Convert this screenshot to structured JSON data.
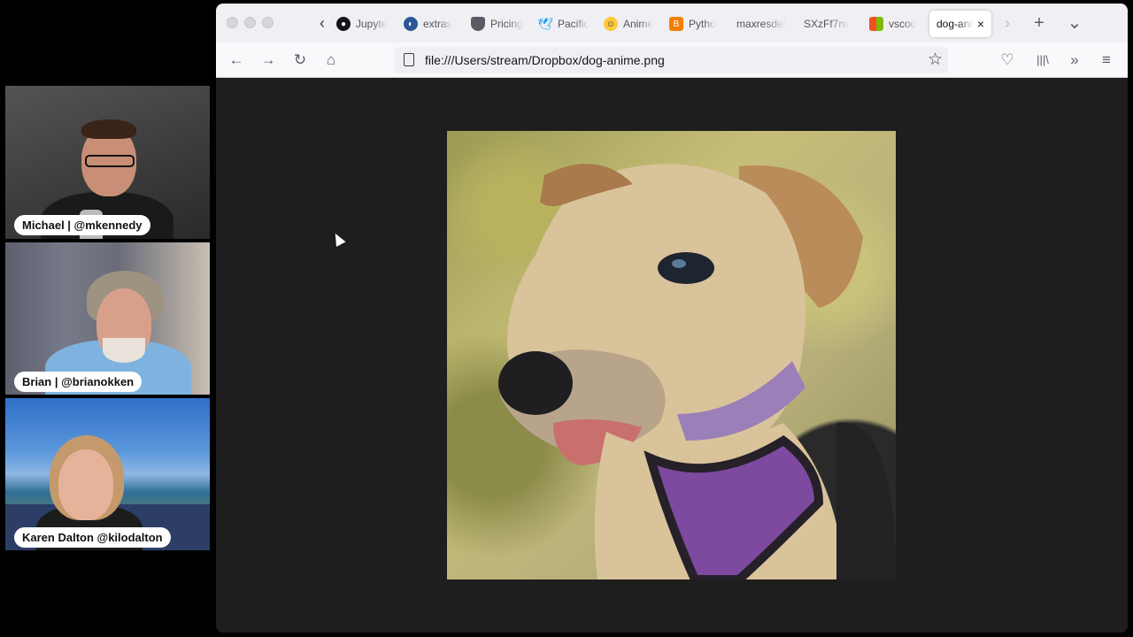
{
  "participants": [
    {
      "name": "Michael | @mkennedy"
    },
    {
      "name": "Brian | @brianokken"
    },
    {
      "name": "Karen Dalton @kilodalton"
    }
  ],
  "browser": {
    "tabs": [
      {
        "title": "Jupyte",
        "icon": "github-icon",
        "color": "#15141a"
      },
      {
        "title": "extras",
        "icon": "globe-icon",
        "color": "#2b5797"
      },
      {
        "title": "Pricing",
        "icon": "shield-icon",
        "color": "#5b5b66"
      },
      {
        "title": "Pacific",
        "icon": "twitter-icon",
        "color": "#1d9bf0"
      },
      {
        "title": "Anime",
        "icon": "hugging-face-icon",
        "color": "#ffc93c"
      },
      {
        "title": "Pytho",
        "icon": "blogger-icon",
        "color": "#f57d00"
      },
      {
        "title": "maxresdef",
        "icon": "",
        "color": ""
      },
      {
        "title": "SXzFf7rw",
        "icon": "",
        "color": ""
      },
      {
        "title": "vscod",
        "icon": "microsoft-icon",
        "color": "#f25022"
      }
    ],
    "active_tab": {
      "title": "dog-anime",
      "close": "×"
    },
    "url": "file:///Users/stream/Dropbox/dog-anime.png",
    "glyphs": {
      "scroll_left": "‹",
      "scroll_right": "›",
      "new_tab": "+",
      "list_tabs": "⌄",
      "back": "←",
      "forward": "→",
      "reload": "↻",
      "home": "⌂",
      "bookmark": "☆",
      "pocket": "♡",
      "library": "|||\\",
      "overflow": "»",
      "menu": "≡"
    }
  },
  "viewer": {
    "image_name": "dog-anime.png"
  }
}
